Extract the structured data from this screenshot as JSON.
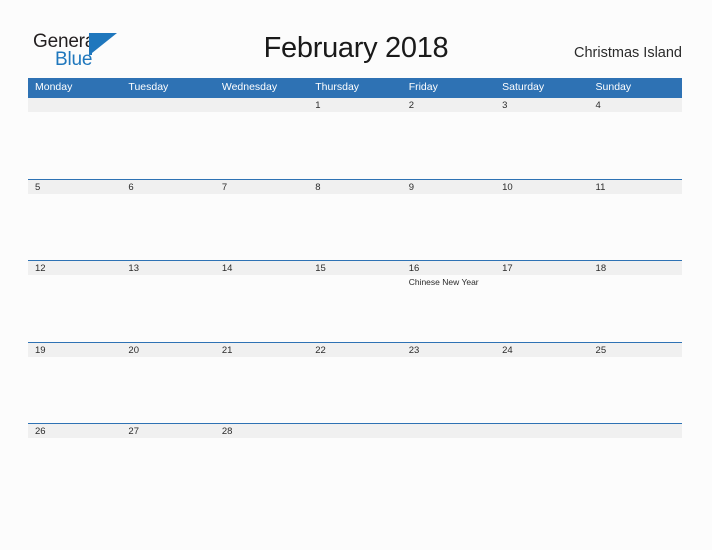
{
  "logo": {
    "word_one": "General",
    "word_two": "Blue",
    "mark": "triangle-mark",
    "color_dark": "#231f20",
    "color_blue": "#1f77bd"
  },
  "header": {
    "title": "February 2018",
    "region": "Christmas Island"
  },
  "theme": {
    "header_blue": "#2e72b4",
    "row_band_gray": "#f0f0f0",
    "page_background": "#fcfcfc",
    "text_dark": "#2b2b2b"
  },
  "calendar": {
    "month": "February",
    "year": "2018",
    "weekday_headers": [
      "Monday",
      "Tuesday",
      "Wednesday",
      "Thursday",
      "Friday",
      "Saturday",
      "Sunday"
    ],
    "weeks": [
      [
        {
          "day": "",
          "event": ""
        },
        {
          "day": "",
          "event": ""
        },
        {
          "day": "",
          "event": ""
        },
        {
          "day": "1",
          "event": ""
        },
        {
          "day": "2",
          "event": ""
        },
        {
          "day": "3",
          "event": ""
        },
        {
          "day": "4",
          "event": ""
        }
      ],
      [
        {
          "day": "5",
          "event": ""
        },
        {
          "day": "6",
          "event": ""
        },
        {
          "day": "7",
          "event": ""
        },
        {
          "day": "8",
          "event": ""
        },
        {
          "day": "9",
          "event": ""
        },
        {
          "day": "10",
          "event": ""
        },
        {
          "day": "11",
          "event": ""
        }
      ],
      [
        {
          "day": "12",
          "event": ""
        },
        {
          "day": "13",
          "event": ""
        },
        {
          "day": "14",
          "event": ""
        },
        {
          "day": "15",
          "event": ""
        },
        {
          "day": "16",
          "event": "Chinese New Year"
        },
        {
          "day": "17",
          "event": ""
        },
        {
          "day": "18",
          "event": ""
        }
      ],
      [
        {
          "day": "19",
          "event": ""
        },
        {
          "day": "20",
          "event": ""
        },
        {
          "day": "21",
          "event": ""
        },
        {
          "day": "22",
          "event": ""
        },
        {
          "day": "23",
          "event": ""
        },
        {
          "day": "24",
          "event": ""
        },
        {
          "day": "25",
          "event": ""
        }
      ],
      [
        {
          "day": "26",
          "event": ""
        },
        {
          "day": "27",
          "event": ""
        },
        {
          "day": "28",
          "event": ""
        },
        {
          "day": "",
          "event": ""
        },
        {
          "day": "",
          "event": ""
        },
        {
          "day": "",
          "event": ""
        },
        {
          "day": "",
          "event": ""
        }
      ]
    ]
  }
}
